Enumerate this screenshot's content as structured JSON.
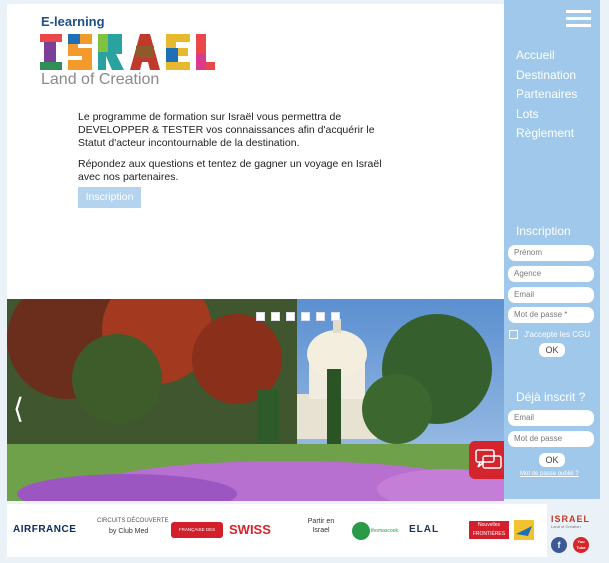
{
  "header": {
    "elearning": "E-learning",
    "brand": "ISRAEL",
    "tagline": "Land of Creation"
  },
  "intro": {
    "paragraph1": "Le programme de formation sur Israël vous permettra de DEVELOPPER & TESTER vos connaissances afin d'acquérir le Statut d'acteur incontournable de la destination.",
    "paragraph2": "Répondez aux questions et tentez de gagner un voyage en Israël avec nos partenaires.",
    "cta": "Inscription"
  },
  "sidebar": {
    "nav": [
      "Accueil",
      "Destination",
      "Partenaires",
      "Lots",
      "Règlement"
    ],
    "register": {
      "title": "Inscription",
      "placeholders": [
        "Prénom",
        "Agence",
        "Email",
        "Mot de passe *"
      ],
      "cgu": "J'accepte les CGU",
      "ok": "OK"
    },
    "login": {
      "title": "Déjà inscrit ?",
      "placeholders": [
        "Email",
        "Mot de passe"
      ],
      "ok": "OK",
      "forgot": "Mot de passe oublié ?"
    }
  },
  "slider": {
    "dot_count": 6,
    "prev_arrow": "⟨"
  },
  "partners": {
    "airfrance": "AIRFRANCE",
    "circuits": "CIRCUITS DÉCOUVERTE",
    "clubmed": "by Club Med",
    "fdc": "FRANÇAISE DES CIRCUITS",
    "swiss": "SWISS",
    "partir": "Partir en Israel",
    "thomascook": "thomascook",
    "elal": "ELAL",
    "nf": "Nouvelles FRONTIÈRES",
    "corner_brand": "ISRAEL",
    "corner_tag": "Land of Creation",
    "facebook": "f",
    "youtube": "You Tube"
  },
  "colors": {
    "sidebar": "#9fc8ea",
    "cta": "#b3d3ee",
    "accent_red": "#d4252f"
  }
}
